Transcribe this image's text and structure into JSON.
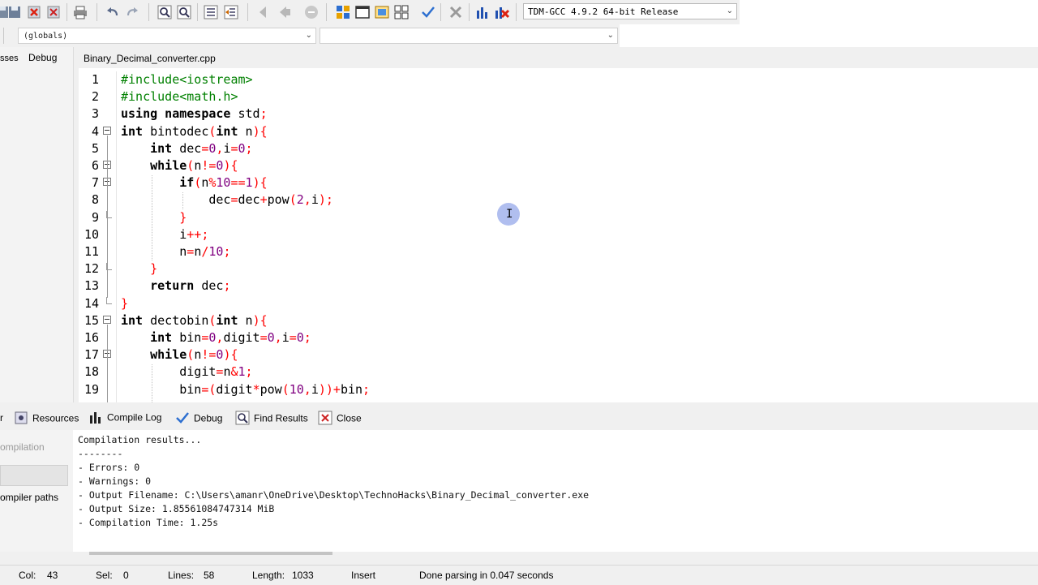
{
  "toolbar": {
    "compiler": "TDM-GCC 4.9.2 64-bit Release"
  },
  "scope": {
    "globals": "(globals)",
    "members": ""
  },
  "left_panel": {
    "tab_classes": "sses",
    "tab_debug": "Debug"
  },
  "editor": {
    "file_tab": "Binary_Decimal_converter.cpp",
    "lines": [
      {
        "n": "1",
        "tokens": [
          [
            "pp",
            "#include<iostream>"
          ]
        ]
      },
      {
        "n": "2",
        "tokens": [
          [
            "pp",
            "#include<math.h>"
          ]
        ]
      },
      {
        "n": "3",
        "tokens": [
          [
            "kw",
            "using namespace"
          ],
          [
            "t",
            " std"
          ],
          [
            "sym",
            ";"
          ]
        ]
      },
      {
        "n": "4",
        "tokens": [
          [
            "kw",
            "int"
          ],
          [
            "t",
            " bintodec"
          ],
          [
            "sym",
            "("
          ],
          [
            "kw",
            "int"
          ],
          [
            "t",
            " n"
          ],
          [
            "sym",
            "){"
          ]
        ]
      },
      {
        "n": "5",
        "tokens": [
          [
            "t",
            "    "
          ],
          [
            "kw",
            "int"
          ],
          [
            "t",
            " dec"
          ],
          [
            "sym",
            "="
          ],
          [
            "num",
            "0"
          ],
          [
            "sym",
            ","
          ],
          [
            "t",
            "i"
          ],
          [
            "sym",
            "="
          ],
          [
            "num",
            "0"
          ],
          [
            "sym",
            ";"
          ]
        ]
      },
      {
        "n": "6",
        "tokens": [
          [
            "t",
            "    "
          ],
          [
            "kw",
            "while"
          ],
          [
            "sym",
            "("
          ],
          [
            "t",
            "n"
          ],
          [
            "sym",
            "!="
          ],
          [
            "num",
            "0"
          ],
          [
            "sym",
            "){"
          ]
        ]
      },
      {
        "n": "7",
        "tokens": [
          [
            "t",
            "        "
          ],
          [
            "kw",
            "if"
          ],
          [
            "sym",
            "("
          ],
          [
            "t",
            "n"
          ],
          [
            "sym",
            "%"
          ],
          [
            "num",
            "10"
          ],
          [
            "sym",
            "=="
          ],
          [
            "num",
            "1"
          ],
          [
            "sym",
            "){"
          ]
        ]
      },
      {
        "n": "8",
        "tokens": [
          [
            "t",
            "            dec"
          ],
          [
            "sym",
            "="
          ],
          [
            "t",
            "dec"
          ],
          [
            "sym",
            "+"
          ],
          [
            "t",
            "pow"
          ],
          [
            "sym",
            "("
          ],
          [
            "num",
            "2"
          ],
          [
            "sym",
            ","
          ],
          [
            "t",
            "i"
          ],
          [
            "sym",
            ");"
          ]
        ]
      },
      {
        "n": "9",
        "tokens": [
          [
            "t",
            "        "
          ],
          [
            "sym",
            "}"
          ]
        ]
      },
      {
        "n": "10",
        "tokens": [
          [
            "t",
            "        i"
          ],
          [
            "sym",
            "++;"
          ]
        ]
      },
      {
        "n": "11",
        "tokens": [
          [
            "t",
            "        n"
          ],
          [
            "sym",
            "="
          ],
          [
            "t",
            "n"
          ],
          [
            "sym",
            "/"
          ],
          [
            "num",
            "10"
          ],
          [
            "sym",
            ";"
          ]
        ]
      },
      {
        "n": "12",
        "tokens": [
          [
            "t",
            "    "
          ],
          [
            "sym",
            "}"
          ]
        ]
      },
      {
        "n": "13",
        "tokens": [
          [
            "t",
            "    "
          ],
          [
            "kw",
            "return"
          ],
          [
            "t",
            " dec"
          ],
          [
            "sym",
            ";"
          ]
        ]
      },
      {
        "n": "14",
        "tokens": [
          [
            "sym",
            "}"
          ]
        ]
      },
      {
        "n": "15",
        "tokens": [
          [
            "kw",
            "int"
          ],
          [
            "t",
            " dectobin"
          ],
          [
            "sym",
            "("
          ],
          [
            "kw",
            "int"
          ],
          [
            "t",
            " n"
          ],
          [
            "sym",
            "){"
          ]
        ]
      },
      {
        "n": "16",
        "tokens": [
          [
            "t",
            "    "
          ],
          [
            "kw",
            "int"
          ],
          [
            "t",
            " bin"
          ],
          [
            "sym",
            "="
          ],
          [
            "num",
            "0"
          ],
          [
            "sym",
            ","
          ],
          [
            "t",
            "digit"
          ],
          [
            "sym",
            "="
          ],
          [
            "num",
            "0"
          ],
          [
            "sym",
            ","
          ],
          [
            "t",
            "i"
          ],
          [
            "sym",
            "="
          ],
          [
            "num",
            "0"
          ],
          [
            "sym",
            ";"
          ]
        ]
      },
      {
        "n": "17",
        "tokens": [
          [
            "t",
            "    "
          ],
          [
            "kw",
            "while"
          ],
          [
            "sym",
            "("
          ],
          [
            "t",
            "n"
          ],
          [
            "sym",
            "!="
          ],
          [
            "num",
            "0"
          ],
          [
            "sym",
            "){"
          ]
        ]
      },
      {
        "n": "18",
        "tokens": [
          [
            "t",
            "        digit"
          ],
          [
            "sym",
            "="
          ],
          [
            "t",
            "n"
          ],
          [
            "sym",
            "&"
          ],
          [
            "num",
            "1"
          ],
          [
            "sym",
            ";"
          ]
        ]
      },
      {
        "n": "19",
        "tokens": [
          [
            "t",
            "        bin"
          ],
          [
            "sym",
            "=("
          ],
          [
            "t",
            "digit"
          ],
          [
            "sym",
            "*"
          ],
          [
            "t",
            "pow"
          ],
          [
            "sym",
            "("
          ],
          [
            "num",
            "10"
          ],
          [
            "sym",
            ","
          ],
          [
            "t",
            "i"
          ],
          [
            "sym",
            "))+"
          ],
          [
            "t",
            "bin"
          ],
          [
            "sym",
            ";"
          ]
        ]
      }
    ]
  },
  "bottom": {
    "tab_compiler": "r",
    "tab_resources": "Resources",
    "tab_compile_log": "Compile Log",
    "tab_debug": "Debug",
    "tab_find": "Find Results",
    "tab_close": "Close",
    "side_compilation": "ompilation",
    "side_paths": "ompiler paths",
    "log": [
      "Compilation results...",
      "--------",
      "- Errors: 0",
      "- Warnings: 0",
      "- Output Filename: C:\\Users\\amanr\\OneDrive\\Desktop\\TechnoHacks\\Binary_Decimal_converter.exe",
      "- Output Size: 1.85561084747314 MiB",
      "- Compilation Time: 1.25s"
    ]
  },
  "status": {
    "col_label": "Col:",
    "col": "43",
    "sel_label": "Sel:",
    "sel": "0",
    "lines_label": "Lines:",
    "lines": "58",
    "length_label": "Length:",
    "length": "1033",
    "mode": "Insert",
    "message": "Done parsing in 0.047 seconds"
  }
}
